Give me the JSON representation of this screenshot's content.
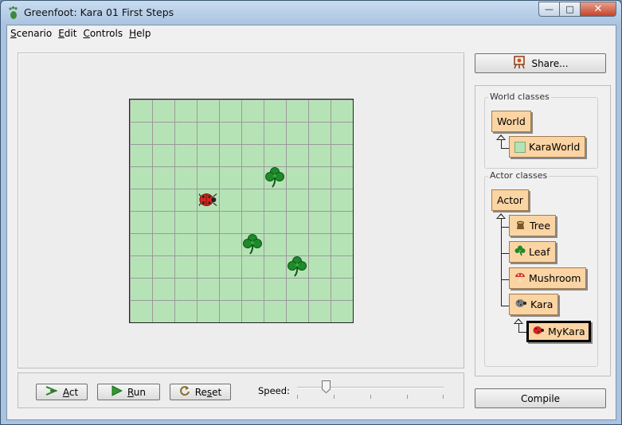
{
  "window": {
    "title": "Greenfoot: Kara 01 First Steps",
    "minimize": "—",
    "maximize": "□",
    "close": "✕"
  },
  "menu": [
    {
      "pre": "",
      "u": "S",
      "post": "cenario"
    },
    {
      "pre": "",
      "u": "E",
      "post": "dit"
    },
    {
      "pre": "",
      "u": "C",
      "post": "ontrols"
    },
    {
      "pre": "",
      "u": "H",
      "post": "elp"
    }
  ],
  "world": {
    "columns": 10,
    "rows": 10,
    "actors": [
      {
        "type": "kara",
        "col": 3,
        "row": 4
      },
      {
        "type": "leaf",
        "col": 6,
        "row": 3
      },
      {
        "type": "leaf",
        "col": 5,
        "row": 6
      },
      {
        "type": "leaf",
        "col": 7,
        "row": 7
      }
    ]
  },
  "controls": {
    "act": {
      "u": "A",
      "rest": "ct"
    },
    "run": {
      "u": "R",
      "rest": "un"
    },
    "reset": {
      "pre": "Re",
      "u": "s",
      "rest": "et"
    },
    "speed_label": "Speed:",
    "speed_fraction": 0.2
  },
  "sidebar": {
    "share_label": "Share...",
    "world_classes_title": "World classes",
    "world_classes": {
      "root": "World",
      "child": "KaraWorld"
    },
    "actor_classes_title": "Actor classes",
    "actor_root": "Actor",
    "actor_children": [
      "Tree",
      "Leaf",
      "Mushroom",
      "Kara"
    ],
    "kara_child": "MyKara",
    "compile_label": "Compile"
  },
  "colors": {
    "grid_fill": "#b6e3b6",
    "class_fill": "#fbd4a3",
    "ladybug": "#d8231f",
    "clover": "#1f8a2a"
  }
}
